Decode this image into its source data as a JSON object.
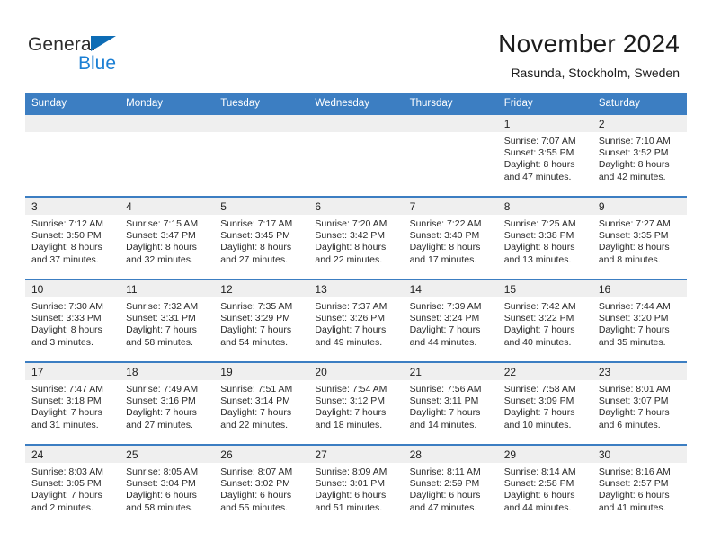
{
  "brand": {
    "name_part1": "General",
    "name_part2": "Blue",
    "triangle_color": "#0d6cb5",
    "blue_color": "#1b7fd4"
  },
  "header": {
    "title": "November 2024",
    "subtitle": "Rasunda, Stockholm, Sweden",
    "header_bg": "#3c7ec2",
    "daynum_band_bg": "#efefef"
  },
  "weekday_headers": [
    "Sunday",
    "Monday",
    "Tuesday",
    "Wednesday",
    "Thursday",
    "Friday",
    "Saturday"
  ],
  "weeks": [
    [
      {
        "day": "",
        "info": ""
      },
      {
        "day": "",
        "info": ""
      },
      {
        "day": "",
        "info": ""
      },
      {
        "day": "",
        "info": ""
      },
      {
        "day": "",
        "info": ""
      },
      {
        "day": "1",
        "info": "Sunrise: 7:07 AM\nSunset: 3:55 PM\nDaylight: 8 hours\nand 47 minutes."
      },
      {
        "day": "2",
        "info": "Sunrise: 7:10 AM\nSunset: 3:52 PM\nDaylight: 8 hours\nand 42 minutes."
      }
    ],
    [
      {
        "day": "3",
        "info": "Sunrise: 7:12 AM\nSunset: 3:50 PM\nDaylight: 8 hours\nand 37 minutes."
      },
      {
        "day": "4",
        "info": "Sunrise: 7:15 AM\nSunset: 3:47 PM\nDaylight: 8 hours\nand 32 minutes."
      },
      {
        "day": "5",
        "info": "Sunrise: 7:17 AM\nSunset: 3:45 PM\nDaylight: 8 hours\nand 27 minutes."
      },
      {
        "day": "6",
        "info": "Sunrise: 7:20 AM\nSunset: 3:42 PM\nDaylight: 8 hours\nand 22 minutes."
      },
      {
        "day": "7",
        "info": "Sunrise: 7:22 AM\nSunset: 3:40 PM\nDaylight: 8 hours\nand 17 minutes."
      },
      {
        "day": "8",
        "info": "Sunrise: 7:25 AM\nSunset: 3:38 PM\nDaylight: 8 hours\nand 13 minutes."
      },
      {
        "day": "9",
        "info": "Sunrise: 7:27 AM\nSunset: 3:35 PM\nDaylight: 8 hours\nand 8 minutes."
      }
    ],
    [
      {
        "day": "10",
        "info": "Sunrise: 7:30 AM\nSunset: 3:33 PM\nDaylight: 8 hours\nand 3 minutes."
      },
      {
        "day": "11",
        "info": "Sunrise: 7:32 AM\nSunset: 3:31 PM\nDaylight: 7 hours\nand 58 minutes."
      },
      {
        "day": "12",
        "info": "Sunrise: 7:35 AM\nSunset: 3:29 PM\nDaylight: 7 hours\nand 54 minutes."
      },
      {
        "day": "13",
        "info": "Sunrise: 7:37 AM\nSunset: 3:26 PM\nDaylight: 7 hours\nand 49 minutes."
      },
      {
        "day": "14",
        "info": "Sunrise: 7:39 AM\nSunset: 3:24 PM\nDaylight: 7 hours\nand 44 minutes."
      },
      {
        "day": "15",
        "info": "Sunrise: 7:42 AM\nSunset: 3:22 PM\nDaylight: 7 hours\nand 40 minutes."
      },
      {
        "day": "16",
        "info": "Sunrise: 7:44 AM\nSunset: 3:20 PM\nDaylight: 7 hours\nand 35 minutes."
      }
    ],
    [
      {
        "day": "17",
        "info": "Sunrise: 7:47 AM\nSunset: 3:18 PM\nDaylight: 7 hours\nand 31 minutes."
      },
      {
        "day": "18",
        "info": "Sunrise: 7:49 AM\nSunset: 3:16 PM\nDaylight: 7 hours\nand 27 minutes."
      },
      {
        "day": "19",
        "info": "Sunrise: 7:51 AM\nSunset: 3:14 PM\nDaylight: 7 hours\nand 22 minutes."
      },
      {
        "day": "20",
        "info": "Sunrise: 7:54 AM\nSunset: 3:12 PM\nDaylight: 7 hours\nand 18 minutes."
      },
      {
        "day": "21",
        "info": "Sunrise: 7:56 AM\nSunset: 3:11 PM\nDaylight: 7 hours\nand 14 minutes."
      },
      {
        "day": "22",
        "info": "Sunrise: 7:58 AM\nSunset: 3:09 PM\nDaylight: 7 hours\nand 10 minutes."
      },
      {
        "day": "23",
        "info": "Sunrise: 8:01 AM\nSunset: 3:07 PM\nDaylight: 7 hours\nand 6 minutes."
      }
    ],
    [
      {
        "day": "24",
        "info": "Sunrise: 8:03 AM\nSunset: 3:05 PM\nDaylight: 7 hours\nand 2 minutes."
      },
      {
        "day": "25",
        "info": "Sunrise: 8:05 AM\nSunset: 3:04 PM\nDaylight: 6 hours\nand 58 minutes."
      },
      {
        "day": "26",
        "info": "Sunrise: 8:07 AM\nSunset: 3:02 PM\nDaylight: 6 hours\nand 55 minutes."
      },
      {
        "day": "27",
        "info": "Sunrise: 8:09 AM\nSunset: 3:01 PM\nDaylight: 6 hours\nand 51 minutes."
      },
      {
        "day": "28",
        "info": "Sunrise: 8:11 AM\nSunset: 2:59 PM\nDaylight: 6 hours\nand 47 minutes."
      },
      {
        "day": "29",
        "info": "Sunrise: 8:14 AM\nSunset: 2:58 PM\nDaylight: 6 hours\nand 44 minutes."
      },
      {
        "day": "30",
        "info": "Sunrise: 8:16 AM\nSunset: 2:57 PM\nDaylight: 6 hours\nand 41 minutes."
      }
    ]
  ]
}
